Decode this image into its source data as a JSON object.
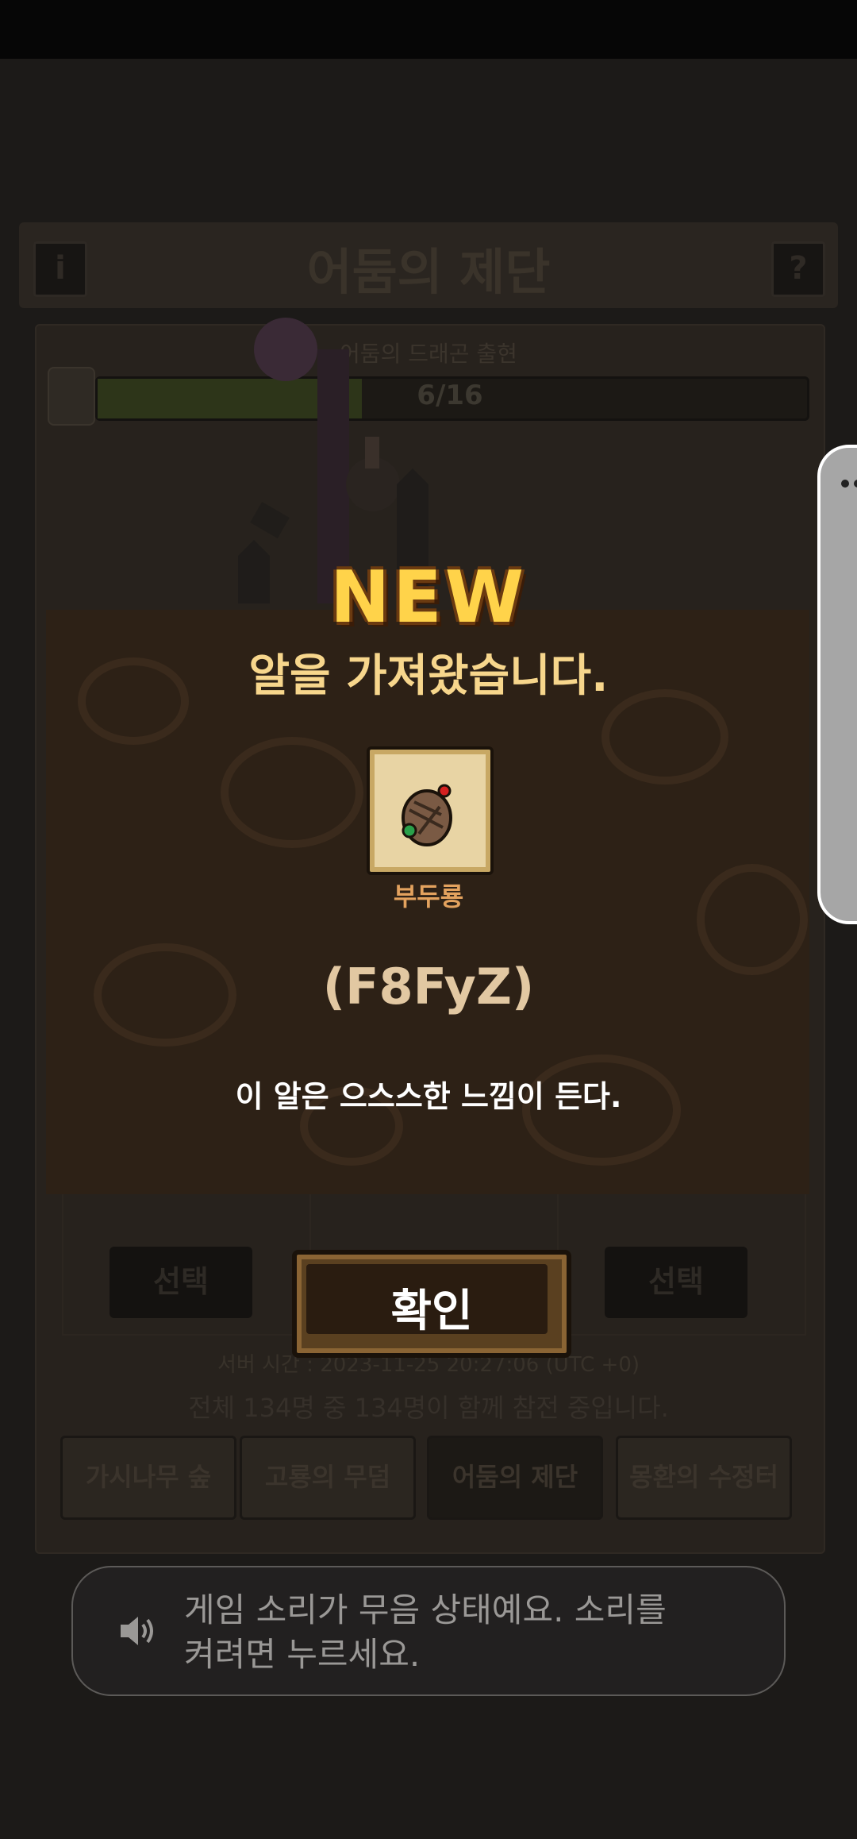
{
  "background": {
    "title": "어둠의 제단",
    "info_button": "i",
    "help_button": "?",
    "subtitle": "어둠의 드래곤 출현",
    "progress_text": "6/16",
    "progress_fraction": 0.375,
    "select_left": "선택",
    "select_right": "선택",
    "server_time": "서버 시간 : 2023-11-25 20:27:06 (UTC +0)",
    "player_count": "전체 134명 중 134명이 함께 참전 중입니다.",
    "tabs": [
      "가시나무 숲",
      "고룡의 무덤",
      "어둠의 제단",
      "몽환의 수정터"
    ],
    "active_tab": 2
  },
  "modal": {
    "badge": "NEW",
    "heading": "알을 가져왔습니다.",
    "item_name": "부두룡",
    "item_code": "(F8FyZ)",
    "description": "이 알은 으스스한 느낌이 든다.",
    "confirm": "확인"
  },
  "toast": {
    "message_line1": "게임 소리가 무음 상태예요. 소리를",
    "message_line2": "켜려면 누르세요."
  },
  "colors": {
    "accent_gold": "#ffd34a",
    "heading": "#f7d68c",
    "item_name": "#e3a25e"
  }
}
